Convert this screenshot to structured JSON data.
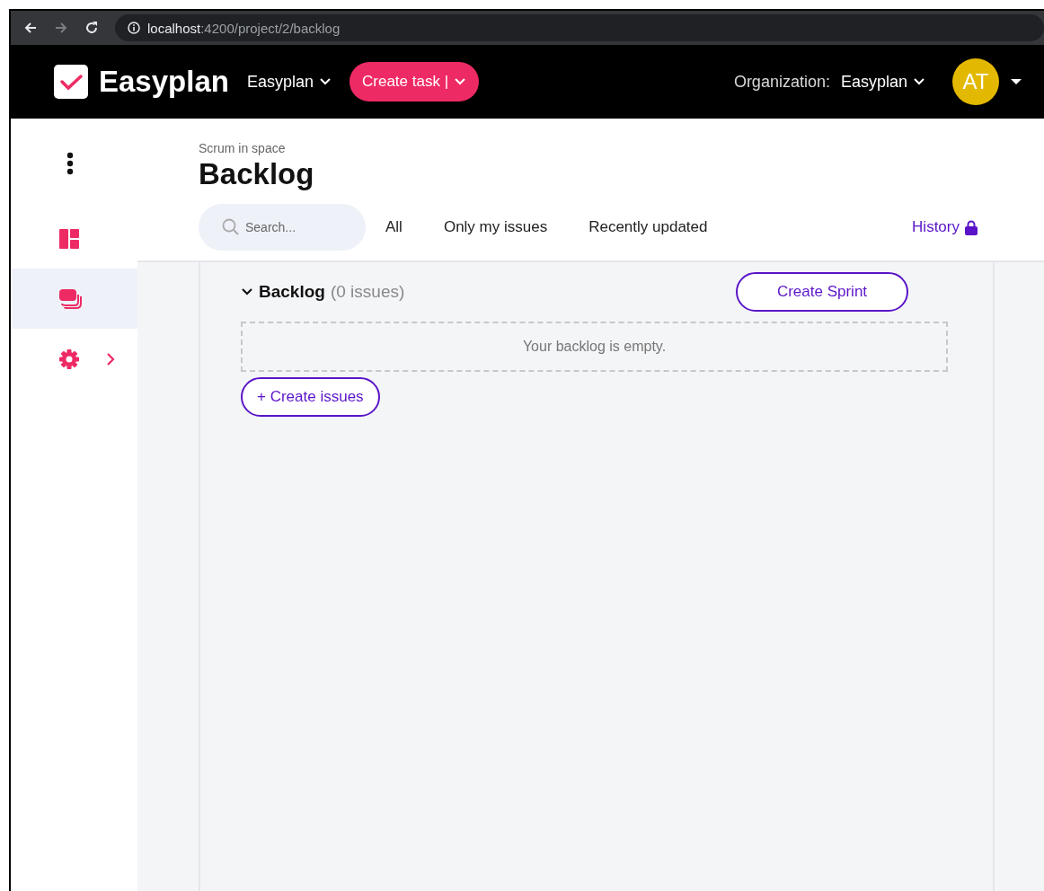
{
  "browser": {
    "url_host": "localhost",
    "url_path": ":4200/project/2/backlog"
  },
  "header": {
    "logo": "Easyplan",
    "project": "Easyplan",
    "create_button": "Create task |",
    "organization_label": "Organization:",
    "organization": "Easyplan",
    "avatar": "AT"
  },
  "sidebar": {
    "items": [
      {
        "kind": "board",
        "selected": false
      },
      {
        "kind": "backlog",
        "selected": true
      },
      {
        "kind": "settings",
        "selected": false
      }
    ]
  },
  "page": {
    "breadcrumb": "Scrum in space",
    "title": "Backlog"
  },
  "search": {
    "placeholder": "Search..."
  },
  "filters": [
    "All",
    "Only my issues",
    "Recently updated"
  ],
  "history": "History",
  "backlog": {
    "title": "Backlog",
    "count": "(0 issues)",
    "expanded": true,
    "create_sprint": "Create Sprint",
    "empty": "Your backlog is empty.",
    "create_issues": "+ Create issues"
  }
}
